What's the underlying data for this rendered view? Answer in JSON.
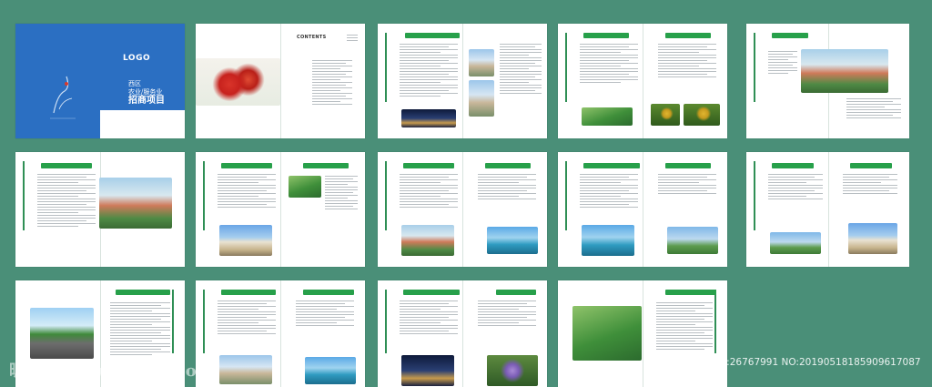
{
  "cover": {
    "logo": "LOGO",
    "title_line1": "西区",
    "title_line2": "农业/服务业",
    "title_line3": "招商项目"
  },
  "contents": {
    "heading": "CONTENTS"
  },
  "watermark": {
    "site": "昵图网 www.nipic.com",
    "id_text": "ID:26767991 NO:20190518185909617087"
  },
  "colors": {
    "background": "#4a8f78",
    "cover_blue": "#2b6fc2",
    "accent_green": "#27a04a"
  }
}
